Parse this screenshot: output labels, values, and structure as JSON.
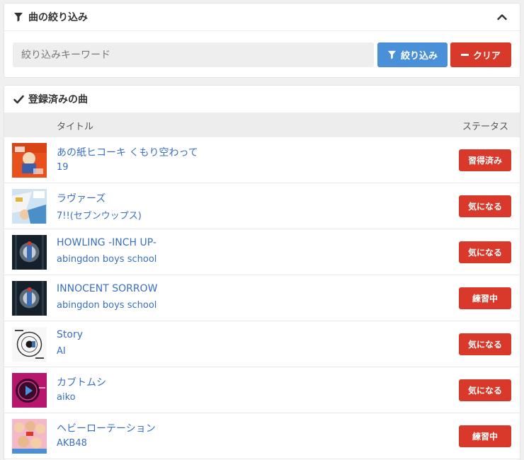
{
  "filter": {
    "title": "曲の絞り込み",
    "search_placeholder": "絞り込みキーワード",
    "filter_button": "絞り込み",
    "clear_button": "クリア"
  },
  "songs": {
    "title": "登録済みの曲",
    "header_title": "タイトル",
    "header_status": "ステータス",
    "items": [
      {
        "title": "あの紙ヒコーキ くもり空わって",
        "artist": "19",
        "status": "習得済み",
        "art": "orange-red"
      },
      {
        "title": "ラヴァーズ",
        "artist": "7!!(セブンウップス)",
        "status": "気になる",
        "art": "light-blue-illustration"
      },
      {
        "title": "HOWLING -INCH UP-",
        "artist": "abingdon boys school",
        "status": "気になる",
        "art": "dark-crest"
      },
      {
        "title": "INNOCENT SORROW",
        "artist": "abingdon boys school",
        "status": "練習中",
        "art": "dark-crest"
      },
      {
        "title": "Story",
        "artist": "AI",
        "status": "気になる",
        "art": "white-sketch"
      },
      {
        "title": "カブトムシ",
        "artist": "aiko",
        "status": "気になる",
        "art": "magenta-disc"
      },
      {
        "title": "ヘビーローテーション",
        "artist": "AKB48",
        "status": "練習中",
        "art": "pink-collage"
      }
    ]
  },
  "colors": {
    "accent_blue": "#4a90d9",
    "danger_red": "#d9392b",
    "link_blue": "#3a6fc4"
  }
}
